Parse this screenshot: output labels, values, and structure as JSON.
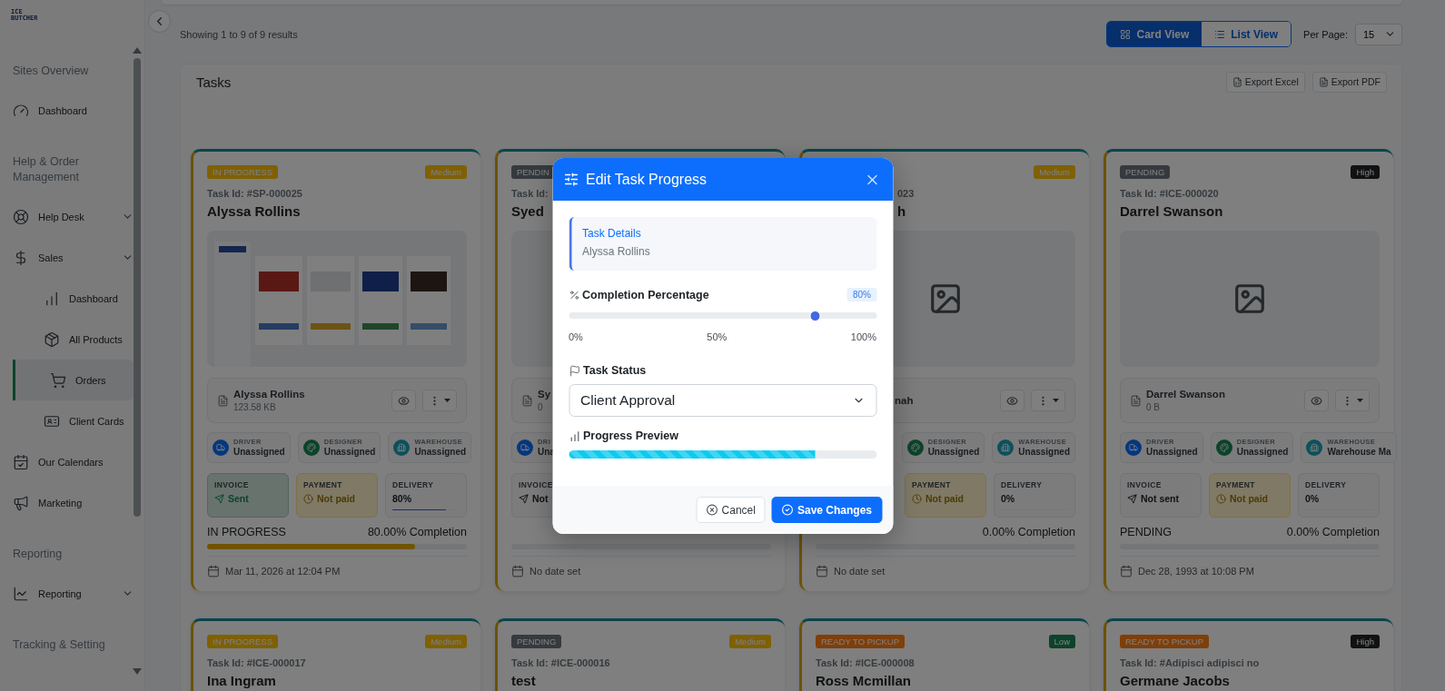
{
  "sidebar": {
    "logo": [
      "ICE",
      "BUTCHER"
    ],
    "sections": [
      {
        "title": "Sites Overview",
        "items": [
          {
            "label": "Dashboard",
            "selected": false,
            "expandable": false
          }
        ]
      },
      {
        "title": "Help & Order Management",
        "items": [
          {
            "label": "Help Desk",
            "selected": false,
            "expandable": true
          },
          {
            "label": "Sales",
            "selected": false,
            "expandable": true,
            "children": [
              {
                "label": "Dashboard",
                "selected": false
              },
              {
                "label": "All Products",
                "selected": false
              },
              {
                "label": "Orders",
                "selected": true
              },
              {
                "label": "Client Cards",
                "selected": false
              }
            ]
          },
          {
            "label": "Our Calendars",
            "selected": false,
            "expandable": false
          },
          {
            "label": "Marketing",
            "selected": false,
            "expandable": false
          }
        ]
      },
      {
        "title": "Reporting",
        "items": [
          {
            "label": "Reporting",
            "selected": false,
            "expandable": true
          }
        ]
      },
      {
        "title": "Tracking & Setting"
      }
    ]
  },
  "toolbar": {
    "results": "Showing 1 to 9 of 9 results",
    "views": [
      {
        "label": "Card View",
        "selected": true
      },
      {
        "label": "List View",
        "selected": false
      }
    ],
    "per_page": {
      "label": "Per Page:",
      "value": "15"
    }
  },
  "panel": {
    "title": "Tasks",
    "exports": [
      "Export Excel",
      "Export PDF"
    ]
  },
  "cards": [
    {
      "status": {
        "label": "IN PROGRESS",
        "kind": "in_progress"
      },
      "priority": {
        "label": "Medium",
        "kind": "medium"
      },
      "task_id": "Task Id: #SP-000025",
      "name": "Alyssa Rollins",
      "image": {
        "kind": "picture"
      },
      "file": {
        "name": "Alyssa Rollins",
        "size": "123.58 KB",
        "actions": true
      },
      "assignees": [
        {
          "kind": "driver",
          "role": "DRIVER",
          "name": "Unassigned"
        },
        {
          "kind": "designer",
          "role": "DESIGNER",
          "name": "Unassigned"
        },
        {
          "kind": "warehouse",
          "role": "WAREHOUSE",
          "name": "Unassigned"
        }
      ],
      "checks": [
        {
          "kind": "invoice",
          "label": "INVOICE",
          "value": "Sent",
          "done": true
        },
        {
          "kind": "payment",
          "label": "PAYMENT",
          "value": "Not paid",
          "done": false
        },
        {
          "kind": "delivery",
          "label": "DELIVERY",
          "value": "80%",
          "level": 0.8
        }
      ],
      "progress": {
        "status": "IN PROGRESS",
        "completion": "80.00% Completion",
        "level": 0.8
      },
      "date": "Mar 11, 2026 at 12:04 PM"
    },
    {
      "status": {
        "label": "PENDIN",
        "kind": "pending"
      },
      "task_id": "Task Id:",
      "name": "Syed",
      "image": {
        "kind": "blank"
      },
      "file": {
        "name": "Sy",
        "size": "0"
      },
      "assignees": [
        {
          "kind": "driver",
          "role": "DRI",
          "name": "Una"
        }
      ],
      "checks": [
        {
          "kind": "invoice",
          "label": "INVOICE",
          "value": "Not",
          "done": false
        }
      ],
      "progress": {
        "level": 0
      },
      "date": "No date set"
    },
    {
      "priority": {
        "label": "Medium",
        "kind": "medium"
      },
      "task_id": "023",
      "name": "h",
      "image": {
        "kind": "placeholder"
      },
      "file": {
        "name": "nah",
        "actions": true
      },
      "assignees": [
        {
          "kind": "designer",
          "role": "DESIGNER",
          "name": "Unassigned"
        },
        {
          "kind": "warehouse",
          "role": "WAREHOUSE",
          "name": "Unassigned"
        }
      ],
      "checks": [
        {
          "kind": "payment",
          "label": "PAYMENT",
          "value": "Not paid",
          "done": false
        },
        {
          "kind": "delivery",
          "label": "DELIVERY",
          "value": "0%",
          "level": 0
        }
      ],
      "progress": {
        "completion": "0.00% Completion",
        "level": 0
      },
      "date": "No date set"
    },
    {
      "status": {
        "label": "PENDING",
        "kind": "pending"
      },
      "priority": {
        "label": "High",
        "kind": "high"
      },
      "task_id": "Task Id: #ICE-000020",
      "name": "Darrel Swanson",
      "image": {
        "kind": "placeholder"
      },
      "file": {
        "name": "Darrel Swanson",
        "size": "0 B",
        "actions": true
      },
      "assignees": [
        {
          "kind": "driver",
          "role": "DRIVER",
          "name": "Unassigned"
        },
        {
          "kind": "designer",
          "role": "DESIGNER",
          "name": "Unassigned"
        },
        {
          "kind": "warehouse",
          "role": "WAREHOUSE",
          "name": "Warehouse Ma"
        }
      ],
      "checks": [
        {
          "kind": "invoice",
          "label": "INVOICE",
          "value": "Not sent",
          "done": false
        },
        {
          "kind": "payment",
          "label": "PAYMENT",
          "value": "Not paid",
          "done": false
        },
        {
          "kind": "delivery",
          "label": "DELIVERY",
          "value": "0%",
          "level": 0
        }
      ],
      "progress": {
        "status": "PENDING",
        "completion": "0.00% Completion",
        "level": 0
      },
      "date": "Dec 28, 1993 at 10:08 PM"
    },
    {
      "status": {
        "label": "IN PROGRESS",
        "kind": "in_progress"
      },
      "priority": {
        "label": "Medium",
        "kind": "medium"
      },
      "task_id": "Task Id: #ICE-000017",
      "name": "Ina Ingram"
    },
    {
      "status": {
        "label": "PENDING",
        "kind": "pending"
      },
      "priority": {
        "label": "Medium",
        "kind": "medium"
      },
      "task_id": "Task Id: #ICE-000016",
      "name": "test"
    },
    {
      "status": {
        "label": "READY TO PICKUP",
        "kind": "ready"
      },
      "priority": {
        "label": "Low",
        "kind": "low"
      },
      "task_id": "Task Id: #ICE-000008",
      "name": "Ross Mcmillan"
    },
    {
      "status": {
        "label": "READY TO PICKUP",
        "kind": "ready"
      },
      "priority": {
        "label": "High",
        "kind": "high"
      },
      "task_id": "Task Id: #Adipisci adipisci no",
      "name": "Germane Jacobs"
    }
  ],
  "modal": {
    "title": "Edit Task Progress",
    "details": {
      "label": "Task Details",
      "value": "Alyssa Rollins"
    },
    "completion": {
      "label": "Completion Percentage",
      "badge": "80%",
      "level": 0.8,
      "ticks": [
        "0%",
        "50%",
        "100%"
      ]
    },
    "status": {
      "label": "Task Status",
      "value": "Client Approval"
    },
    "preview": {
      "label": "Progress Preview",
      "level": 0.8
    },
    "buttons": [
      {
        "label": "Cancel",
        "kind": "secondary"
      },
      {
        "label": "Save Changes",
        "kind": "primary"
      }
    ]
  }
}
